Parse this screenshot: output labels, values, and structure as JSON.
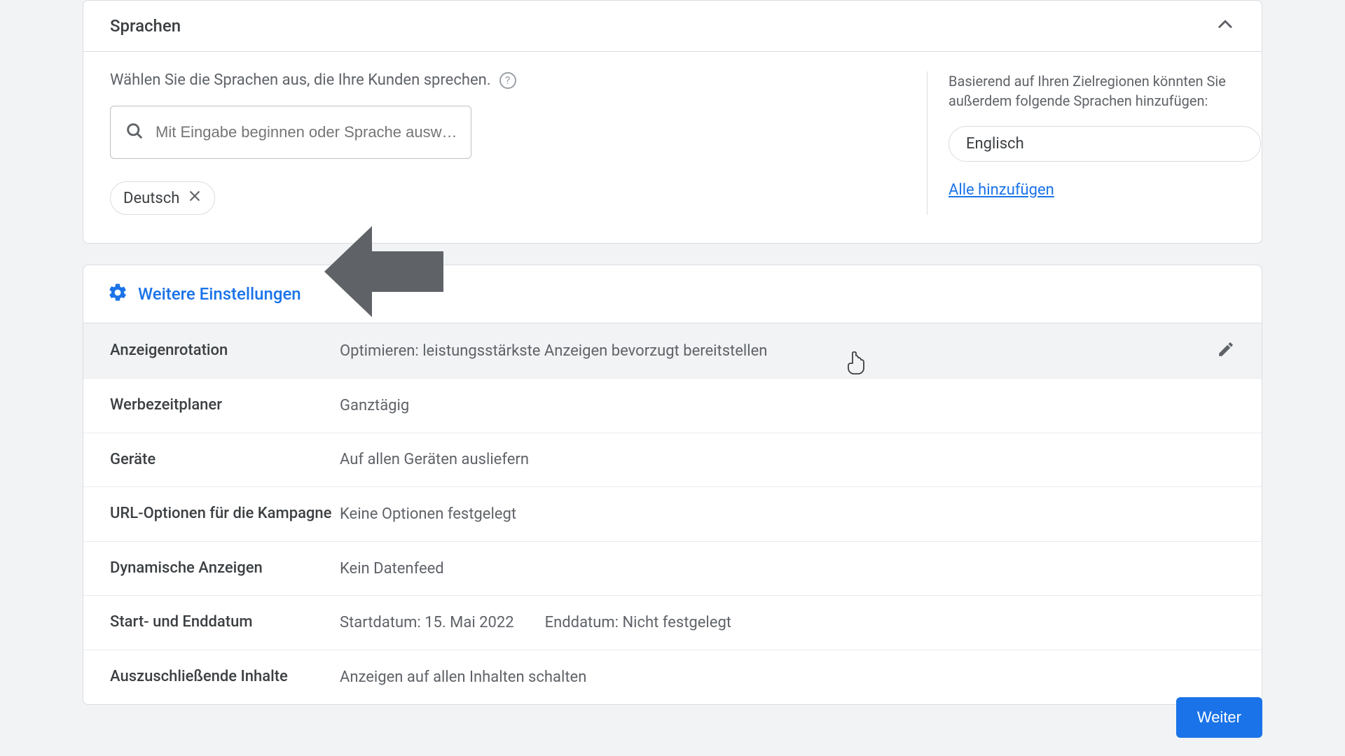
{
  "languages_panel": {
    "title": "Sprachen",
    "instruction": "Wählen Sie die Sprachen aus, die Ihre Kunden sprechen.",
    "search_placeholder": "Mit Eingabe beginnen oder Sprache ausw…",
    "selected_chip": "Deutsch",
    "suggest_text": "Basierend auf Ihren Zielregionen könnten Sie außerdem folgende Sprachen hinzufügen:",
    "suggest_chip": "Englisch",
    "add_all": "Alle hinzufügen"
  },
  "more_settings": {
    "title": "Weitere Einstellungen",
    "rows": [
      {
        "label": "Anzeigenrotation",
        "value": "Optimieren: leistungsstärkste Anzeigen bevorzugt bereitstellen",
        "hovered": true
      },
      {
        "label": "Werbezeitplaner",
        "value": "Ganztägig"
      },
      {
        "label": "Geräte",
        "value": "Auf allen Geräten ausliefern"
      },
      {
        "label": "URL-Optionen für die Kampagne",
        "value": "Keine Optionen festgelegt"
      },
      {
        "label": "Dynamische Anzeigen",
        "value": "Kein Datenfeed"
      },
      {
        "label": "Start- und Enddatum",
        "value_parts": [
          {
            "k": "Startdatum: ",
            "v": "15. Mai 2022"
          },
          {
            "k": "Enddatum: ",
            "v": "Nicht festgelegt"
          }
        ]
      },
      {
        "label": "Auszuschließende Inhalte",
        "value": "Anzeigen auf allen Inhalten schalten"
      }
    ]
  },
  "continue_label": "Weiter"
}
